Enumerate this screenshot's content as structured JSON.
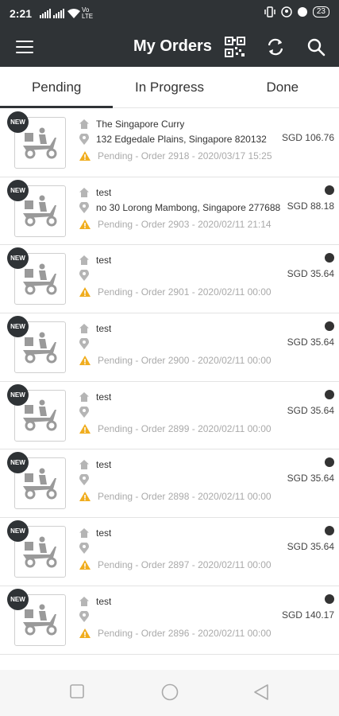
{
  "status_bar": {
    "time": "2:21",
    "network": "Vo LTE",
    "battery": "23"
  },
  "app_bar": {
    "title": "My Orders",
    "icons": [
      "menu-icon",
      "qr-code-icon",
      "refresh-icon",
      "search-icon"
    ]
  },
  "tabs": [
    {
      "label": "Pending",
      "active": true
    },
    {
      "label": "In Progress",
      "active": false
    },
    {
      "label": "Done",
      "active": false
    }
  ],
  "badge_text": "NEW",
  "colors": {
    "header": "#2f3336",
    "warning": "#f0ad1e",
    "status_text": "#aaaaaa"
  },
  "orders": [
    {
      "name": "The Singapore Curry",
      "address": "132 Edgedale Plains, Singapore 820132",
      "status": "Pending - Order 2918 - 2020/03/17 15:25",
      "price": "SGD 106.76",
      "unread_dot": false
    },
    {
      "name": "test",
      "address": "no 30 Lorong Mambong, Singapore 277688",
      "status": "Pending - Order 2903 - 2020/02/11 21:14",
      "price": "SGD 88.18",
      "unread_dot": true
    },
    {
      "name": "test",
      "address": "",
      "status": "Pending - Order 2901 - 2020/02/11 00:00",
      "price": "SGD 35.64",
      "unread_dot": true
    },
    {
      "name": "test",
      "address": "",
      "status": "Pending - Order 2900 - 2020/02/11 00:00",
      "price": "SGD 35.64",
      "unread_dot": true
    },
    {
      "name": "test",
      "address": "",
      "status": "Pending - Order 2899 - 2020/02/11 00:00",
      "price": "SGD 35.64",
      "unread_dot": true
    },
    {
      "name": "test",
      "address": "",
      "status": "Pending - Order 2898 - 2020/02/11 00:00",
      "price": "SGD 35.64",
      "unread_dot": true
    },
    {
      "name": "test",
      "address": "",
      "status": "Pending - Order 2897 - 2020/02/11 00:00",
      "price": "SGD 35.64",
      "unread_dot": true
    },
    {
      "name": "test",
      "address": "",
      "status": "Pending - Order 2896 - 2020/02/11 00:00",
      "price": "SGD 140.17",
      "unread_dot": true
    }
  ],
  "nav_bar": {
    "buttons": [
      "recents-button",
      "home-button",
      "back-button"
    ]
  }
}
